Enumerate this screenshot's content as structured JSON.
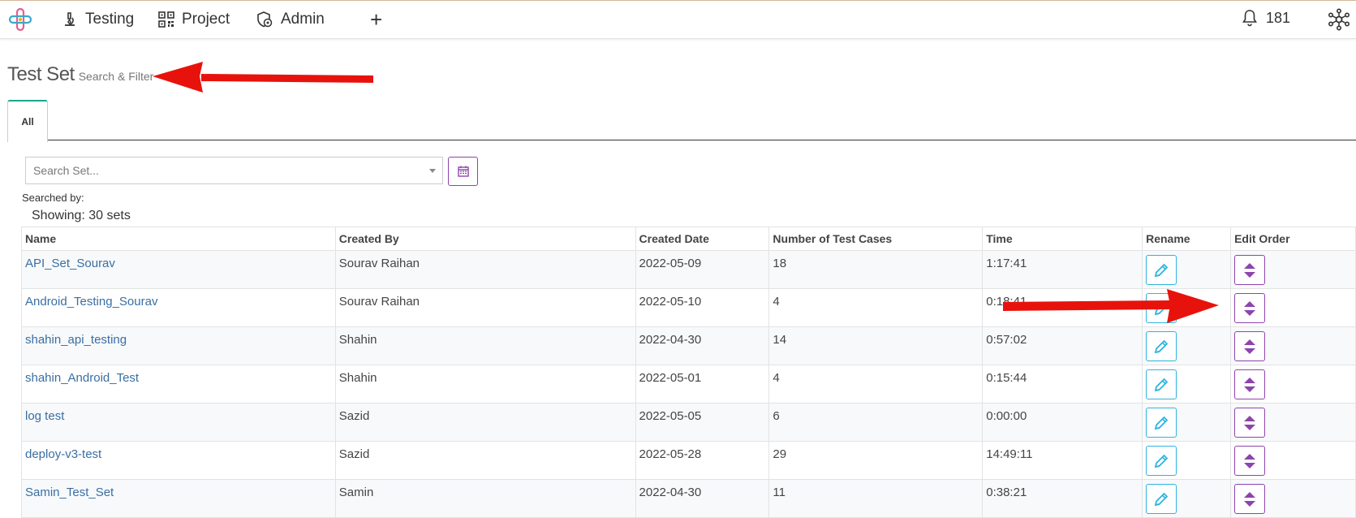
{
  "nav": {
    "items": [
      {
        "label": "Testing",
        "icon": "microscope-icon"
      },
      {
        "label": "Project",
        "icon": "qr-code-icon"
      },
      {
        "label": "Admin",
        "icon": "shield-gear-icon"
      }
    ],
    "add_label": "+",
    "notification_count": "181"
  },
  "page": {
    "title": "Test Set",
    "subtitle": "Search & Filter",
    "tab_all": "All"
  },
  "search": {
    "placeholder": "Search Set...",
    "searched_by": "Searched by:",
    "showing": "Showing: 30 sets"
  },
  "table": {
    "headers": [
      "Name",
      "Created By",
      "Created Date",
      "Number of Test Cases",
      "Time",
      "Rename",
      "Edit Order"
    ],
    "rows": [
      {
        "name": "API_Set_Sourav",
        "created_by": "Sourav Raihan",
        "date": "2022-05-09",
        "cases": "18",
        "time": "1:17:41"
      },
      {
        "name": "Android_Testing_Sourav",
        "created_by": "Sourav Raihan",
        "date": "2022-05-10",
        "cases": "4",
        "time": "0:18:41"
      },
      {
        "name": "shahin_api_testing",
        "created_by": "Shahin",
        "date": "2022-04-30",
        "cases": "14",
        "time": "0:57:02"
      },
      {
        "name": "shahin_Android_Test",
        "created_by": "Shahin",
        "date": "2022-05-01",
        "cases": "4",
        "time": "0:15:44"
      },
      {
        "name": "log test",
        "created_by": "Sazid",
        "date": "2022-05-05",
        "cases": "6",
        "time": "0:00:00"
      },
      {
        "name": "deploy-v3-test",
        "created_by": "Sazid",
        "date": "2022-05-28",
        "cases": "29",
        "time": "14:49:11"
      },
      {
        "name": "Samin_Test_Set",
        "created_by": "Samin",
        "date": "2022-04-30",
        "cases": "11",
        "time": "0:38:21"
      }
    ]
  },
  "colors": {
    "accent_purple": "#8e44ad",
    "accent_blue": "#2fb4e0",
    "tab_green": "#1aa68c",
    "link": "#3a6fa3",
    "annotation_arrow": "#e8120c"
  }
}
